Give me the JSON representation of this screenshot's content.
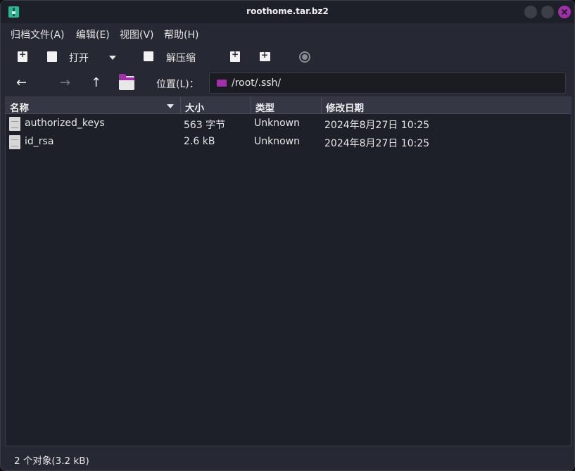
{
  "window": {
    "title": "roothome.tar.bz2"
  },
  "menu": [
    "归档文件(A)",
    "编辑(E)",
    "视图(V)",
    "帮助(H)"
  ],
  "toolbar": {
    "open_label": "打开",
    "extract_label": "解压缩"
  },
  "location": {
    "label": "位置(L)：",
    "path": "/root/.ssh/"
  },
  "columns": {
    "name": "名称",
    "size": "大小",
    "type": "类型",
    "modified": "修改日期"
  },
  "files": [
    {
      "name": "authorized_keys",
      "size": "563 字节",
      "type": "Unknown",
      "modified": "2024年8月27日 10:25"
    },
    {
      "name": "id_rsa",
      "size": "2.6 kB",
      "type": "Unknown",
      "modified": "2024年8月27日 10:25"
    }
  ],
  "status": "2 个对象(3.2 kB)"
}
